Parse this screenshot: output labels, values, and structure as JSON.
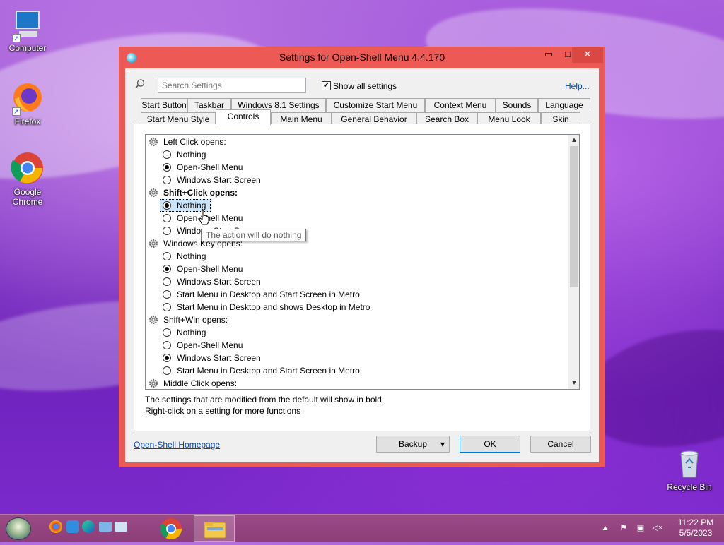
{
  "desktop": {
    "icons": [
      {
        "label": "Computer"
      },
      {
        "label": "Firefox"
      },
      {
        "label": "Google Chrome"
      },
      {
        "label": "Recycle Bin"
      }
    ]
  },
  "window": {
    "title": "Settings for Open-Shell Menu 4.4.170",
    "controls": {
      "minimize": "▭",
      "maximize": "□",
      "close": "✕"
    }
  },
  "toolbar": {
    "search_placeholder": "Search Settings",
    "show_all_label": "Show all settings",
    "show_all_checked": true,
    "checkmark": "✔",
    "help_label": "Help..."
  },
  "tabs": {
    "row1": [
      "Start Button",
      "Taskbar",
      "Windows 8.1 Settings",
      "Customize Start Menu",
      "Context Menu",
      "Sounds",
      "Language"
    ],
    "row2": [
      "Start Menu Style",
      "Controls",
      "Main Menu",
      "General Behavior",
      "Search Box",
      "Menu Look",
      "Skin"
    ],
    "active": "Controls"
  },
  "settings": {
    "groups": [
      {
        "label": "Left Click opens:",
        "options": [
          "Nothing",
          "Open-Shell Menu",
          "Windows Start Screen"
        ],
        "selected": "Open-Shell Menu"
      },
      {
        "label": "Shift+Click opens:",
        "options": [
          "Nothing",
          "Open-Shell Menu",
          "Windows Start Screen"
        ],
        "selected": "Nothing"
      },
      {
        "label": "Windows Key opens:",
        "options": [
          "Nothing",
          "Open-Shell Menu",
          "Windows Start Screen",
          "Start Menu in Desktop and Start Screen in Metro",
          "Start Menu in Desktop and shows Desktop in Metro"
        ],
        "selected": "Open-Shell Menu"
      },
      {
        "label": "Shift+Win opens:",
        "options": [
          "Nothing",
          "Open-Shell Menu",
          "Windows Start Screen",
          "Start Menu in Desktop and Start Screen in Metro"
        ],
        "selected": "Windows Start Screen"
      },
      {
        "label": "Middle Click opens:",
        "options": [],
        "selected": ""
      }
    ],
    "tooltip": "The action will do nothing"
  },
  "info": {
    "line1": "The settings that are modified from the default will show in bold",
    "line2": "Right-click on a setting for more functions"
  },
  "footer": {
    "homepage_link": "Open-Shell Homepage",
    "backup_label": "Backup",
    "backup_arrow": "▾",
    "ok_label": "OK",
    "cancel_label": "Cancel"
  },
  "taskbar": {
    "clock_time": "11:22 PM",
    "clock_date": "5/5/2023",
    "tray_arrow": "▲"
  }
}
